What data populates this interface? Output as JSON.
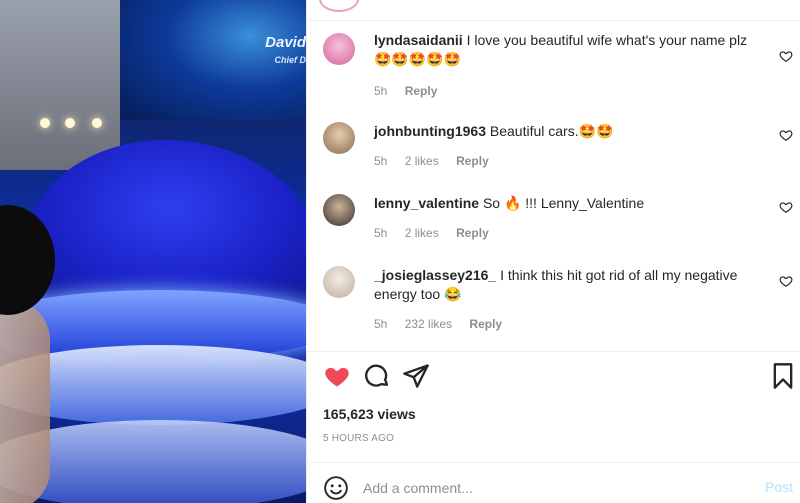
{
  "media": {
    "screen_name": "David",
    "screen_subtitle": "Chief D"
  },
  "comments": [
    {
      "username": "lyndasaidanii",
      "text": "I love you beautiful wife what's your name plz",
      "emoji_line": "🤩🤩🤩🤩🤩",
      "time": "5h",
      "likes": "",
      "reply_label": "Reply",
      "avatar_color": "#e07ab0"
    },
    {
      "username": "johnbunting1963",
      "text": "Beautiful cars.🤩🤩",
      "emoji_line": "",
      "time": "5h",
      "likes": "2 likes",
      "reply_label": "Reply",
      "avatar_color": "#b89a7a"
    },
    {
      "username": "lenny_valentine",
      "text": "So 🔥 !!! Lenny_Valentine",
      "emoji_line": "",
      "time": "5h",
      "likes": "2 likes",
      "reply_label": "Reply",
      "avatar_color": "#6b5a4e"
    },
    {
      "username": "_josieglassey216_",
      "text": "I think this hit got rid of all my negative energy too 😂",
      "emoji_line": "",
      "time": "5h",
      "likes": "232 likes",
      "reply_label": "Reply",
      "avatar_color": "#cfc3b8"
    }
  ],
  "post": {
    "views": "165,623 views",
    "posted": "5 HOURS AGO",
    "liked_color": "#ed4956"
  },
  "add_comment": {
    "placeholder": "Add a comment...",
    "post_label": "Post"
  }
}
